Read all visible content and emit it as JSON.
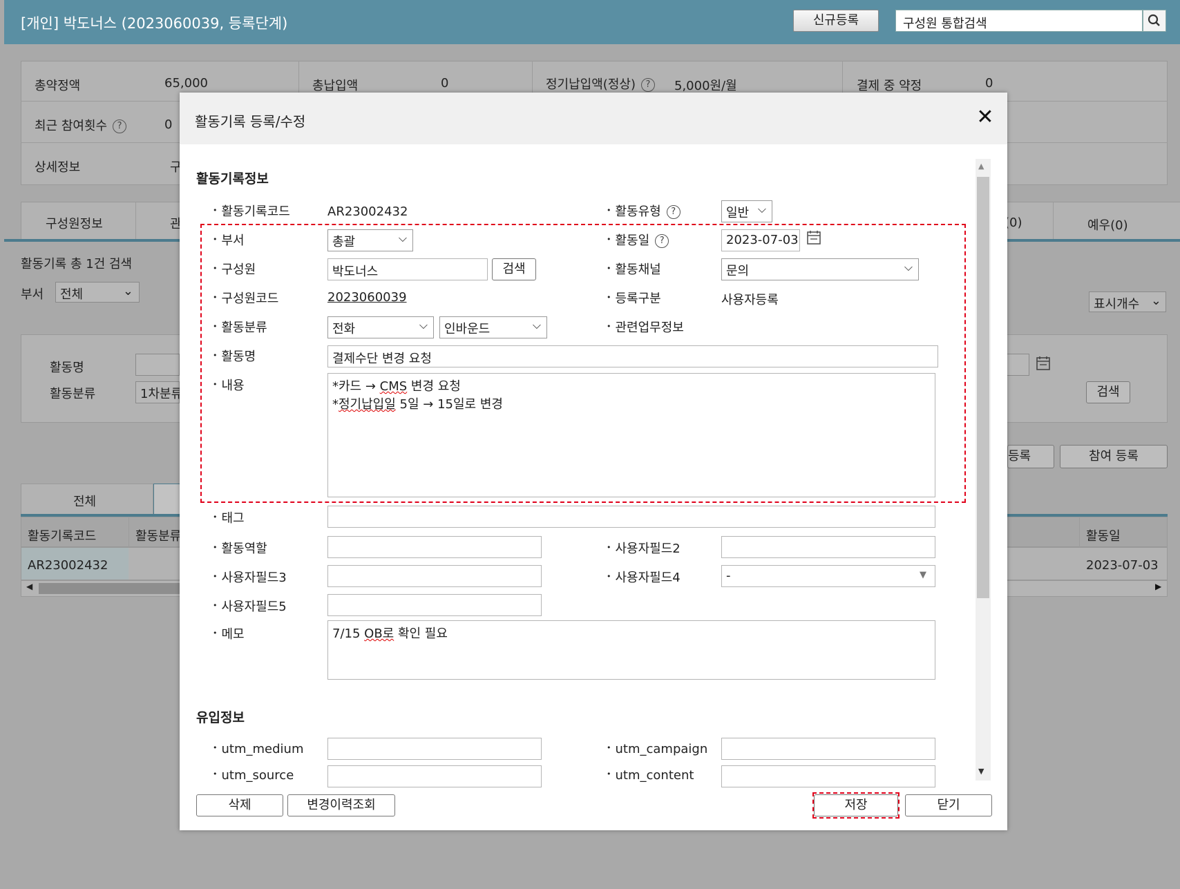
{
  "header": {
    "title": "[개인] 박도너스 (2023060039, 등록단계)",
    "new_register": "신규등록",
    "search_placeholder": "구성원 통합검색"
  },
  "summary": {
    "total_pledge_label": "총약정액",
    "total_pledge_value": "65,000",
    "total_paid_label": "총납입액",
    "total_paid_value": "0",
    "regular_label": "정기납입액(정상)",
    "regular_value": "5,000원/월",
    "in_payment_label": "결제 중 약정",
    "in_payment_value": "0",
    "recent_label": "최근 참여횟수",
    "recent_value": "0",
    "detail_label": "상세정보",
    "detail_value": "구"
  },
  "bg_tabs": {
    "member_info": "구성원정보",
    "second": "관",
    "count_tab": "(0)",
    "courtesy": "예우(0)"
  },
  "bg_list": {
    "count_text": "활동기록 총 1건 검색",
    "dept_label": "부서",
    "dept_value": "전체",
    "display_count": "표시개수",
    "filter_name_label": "활동명",
    "filter_class_label": "활동분류",
    "filter_class_value": "1차분류",
    "search_btn": "검색",
    "reg_btn": "등록",
    "join_btn": "참여 등록",
    "tab_all": "전체",
    "col_code": "활동기록코드",
    "col_class": "활동분류",
    "col_date": "활동일",
    "row_code": "AR23002432",
    "row_date": "2023-07-03"
  },
  "modal": {
    "title": "활동기록 등록/수정",
    "section_activity": "활동기록정보",
    "section_inflow": "유입정보",
    "fields": {
      "code_label": "활동기록코드",
      "code_value": "AR23002432",
      "type_label": "활동유형",
      "type_value": "일반",
      "dept_label": "부서",
      "dept_value": "총괄",
      "date_label": "활동일",
      "date_value": "2023-07-03",
      "member_label": "구성원",
      "member_value": "박도너스",
      "member_search": "검색",
      "channel_label": "활동채널",
      "channel_value": "문의",
      "member_code_label": "구성원코드",
      "member_code_value": "2023060039",
      "reg_type_label": "등록구분",
      "reg_type_value": "사용자등록",
      "class_label": "활동분류",
      "class_value1": "전화",
      "class_value2": "인바운드",
      "related_label": "관련업무정보",
      "name_label": "활동명",
      "name_value": "결제수단 변경 요청",
      "content_label": "내용",
      "content_line1_a": "*카드 → ",
      "content_line1_b": "CMS",
      "content_line1_c": " 변경 요청",
      "content_line2_a": "*",
      "content_line2_b": "정기납입일",
      "content_line2_c": " 5일 → 15일로 변경",
      "tag_label": "태그",
      "role_label": "활동역할",
      "uf2_label": "사용자필드2",
      "uf3_label": "사용자필드3",
      "uf4_label": "사용자필드4",
      "uf4_value": "-",
      "uf5_label": "사용자필드5",
      "memo_label": "메모",
      "memo_a": "7/15 ",
      "memo_b": "OB로",
      "memo_c": " 확인 필요",
      "utm_medium_label": "utm_medium",
      "utm_campaign_label": "utm_campaign",
      "utm_source_label": "utm_source",
      "utm_content_label": "utm_content"
    },
    "buttons": {
      "delete": "삭제",
      "history": "변경이력조회",
      "save": "저장",
      "close": "닫기"
    }
  },
  "icons": {
    "close": "close-icon",
    "calendar": "calendar-icon",
    "search": "search-icon",
    "help": "help-icon"
  }
}
